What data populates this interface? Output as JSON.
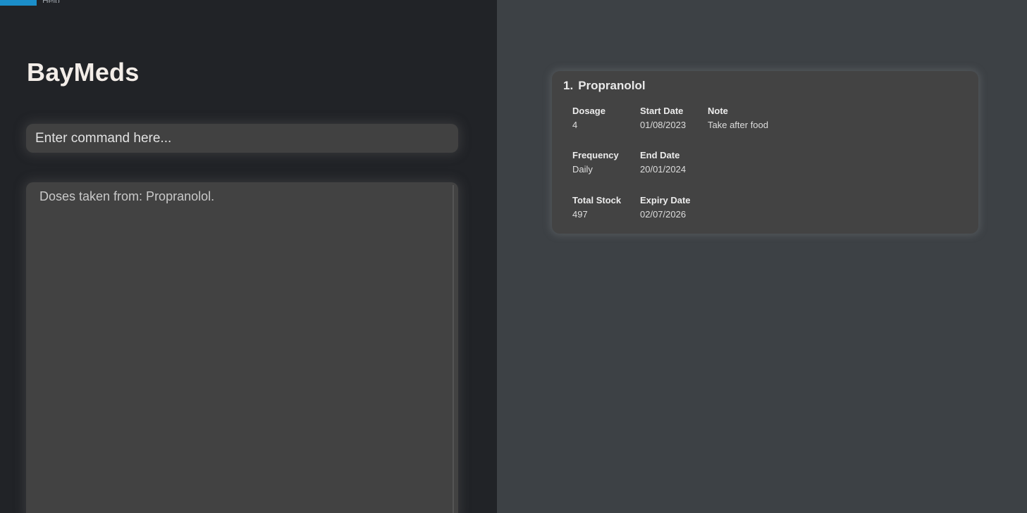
{
  "app": {
    "title": "BayMeds",
    "menu_tab_label": "Help"
  },
  "command": {
    "placeholder": "Enter command here...",
    "value": ""
  },
  "result": {
    "message": "Doses taken from: Propranolol."
  },
  "medications": [
    {
      "index": "1.",
      "name": "Propranolol",
      "dosage_label": "Dosage",
      "dosage": "4",
      "start_date_label": "Start Date",
      "start_date": "01/08/2023",
      "note_label": "Note",
      "note": "Take after food",
      "frequency_label": "Frequency",
      "frequency": "Daily",
      "end_date_label": "End Date",
      "end_date": "20/01/2024",
      "total_stock_label": "Total Stock",
      "total_stock": "497",
      "expiry_date_label": "Expiry Date",
      "expiry_date": "02/07/2026"
    }
  ],
  "colors": {
    "left_pane_bg": "#212327",
    "right_pane_bg": "#3d4145",
    "card_bg": "#434343",
    "accent": "#1b8ec9"
  }
}
